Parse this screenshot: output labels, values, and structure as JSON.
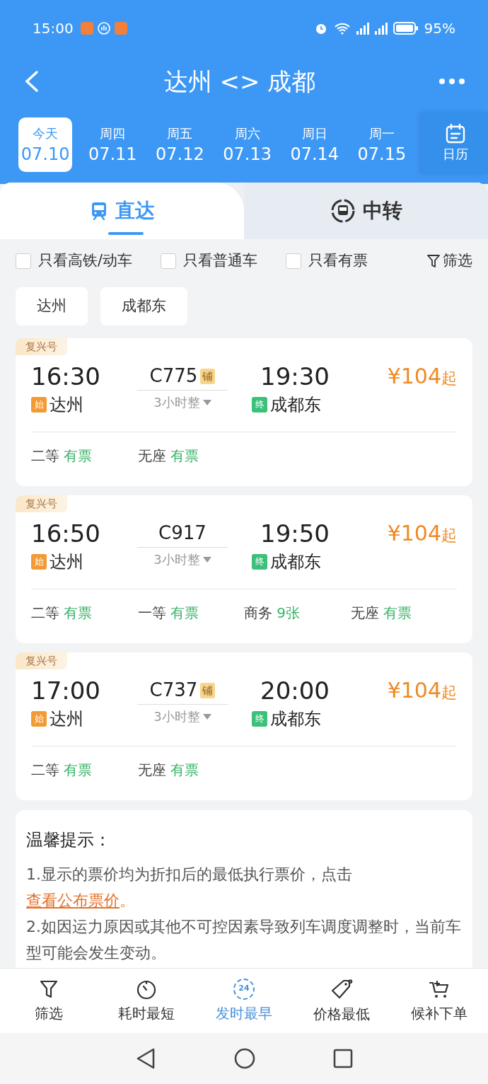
{
  "status_bar": {
    "time": "15:00",
    "battery": "95%"
  },
  "header": {
    "title": "达州 <> 成都"
  },
  "dates": [
    {
      "weekday": "今天",
      "date": "07.10",
      "selected": true
    },
    {
      "weekday": "周四",
      "date": "07.11",
      "selected": false
    },
    {
      "weekday": "周五",
      "date": "07.12",
      "selected": false
    },
    {
      "weekday": "周六",
      "date": "07.13",
      "selected": false
    },
    {
      "weekday": "周日",
      "date": "07.14",
      "selected": false
    },
    {
      "weekday": "周一",
      "date": "07.15",
      "selected": false
    }
  ],
  "calendar_button": {
    "label": "日历"
  },
  "tabs": [
    {
      "label": "直达",
      "kind": "direct",
      "selected": true
    },
    {
      "label": "中转",
      "kind": "transfer",
      "selected": false
    }
  ],
  "filters": [
    {
      "label": "只看高铁/动车",
      "checked": false
    },
    {
      "label": "只看普通车",
      "checked": false
    },
    {
      "label": "只看有票",
      "checked": false
    }
  ],
  "filter_button": {
    "label": "筛选"
  },
  "stations": [
    "达州",
    "成都东"
  ],
  "trains": [
    {
      "brand": "复兴号",
      "depart_time": "16:30",
      "train_no": "C775",
      "tag": "铺",
      "arrive_time": "19:30",
      "duration": "3小时整",
      "from_mark": "始",
      "from": "达州",
      "to_mark": "终",
      "to": "成都东",
      "price": "¥104",
      "price_suffix": "起",
      "seats": [
        {
          "class": "二等",
          "availability": "有票"
        },
        {
          "class": "无座",
          "availability": "有票"
        }
      ]
    },
    {
      "brand": "复兴号",
      "depart_time": "16:50",
      "train_no": "C917",
      "arrive_time": "19:50",
      "duration": "3小时整",
      "from_mark": "始",
      "from": "达州",
      "to_mark": "终",
      "to": "成都东",
      "price": "¥104",
      "price_suffix": "起",
      "seats": [
        {
          "class": "二等",
          "availability": "有票"
        },
        {
          "class": "一等",
          "availability": "有票"
        },
        {
          "class": "商务",
          "availability": "9张"
        },
        {
          "class": "无座",
          "availability": "有票"
        }
      ]
    },
    {
      "brand": "复兴号",
      "depart_time": "17:00",
      "train_no": "C737",
      "tag": "铺",
      "arrive_time": "20:00",
      "duration": "3小时整",
      "from_mark": "始",
      "from": "达州",
      "to_mark": "终",
      "to": "成都东",
      "price": "¥104",
      "price_suffix": "起",
      "seats": [
        {
          "class": "二等",
          "availability": "有票"
        },
        {
          "class": "无座",
          "availability": "有票"
        }
      ]
    }
  ],
  "notice": {
    "title": "温馨提示：",
    "items": [
      {
        "text": "1.显示的票价均为折扣后的最低执行票价，点击 ",
        "link": "查看公布票价",
        "after": "。"
      },
      {
        "text": "2.如因运力原因或其他不可控因素导致列车调度调整时，当前车型可能会发生变动。"
      }
    ]
  },
  "bottom_nav": [
    {
      "label": "筛选",
      "kind": "filter",
      "selected": false
    },
    {
      "label": "耗时最短",
      "kind": "duration",
      "selected": false
    },
    {
      "label": "发时最早",
      "kind": "earliest",
      "badge": "24",
      "selected": true
    },
    {
      "label": "价格最低",
      "kind": "price",
      "selected": false
    },
    {
      "label": "候补下单",
      "kind": "cart",
      "selected": false
    }
  ]
}
